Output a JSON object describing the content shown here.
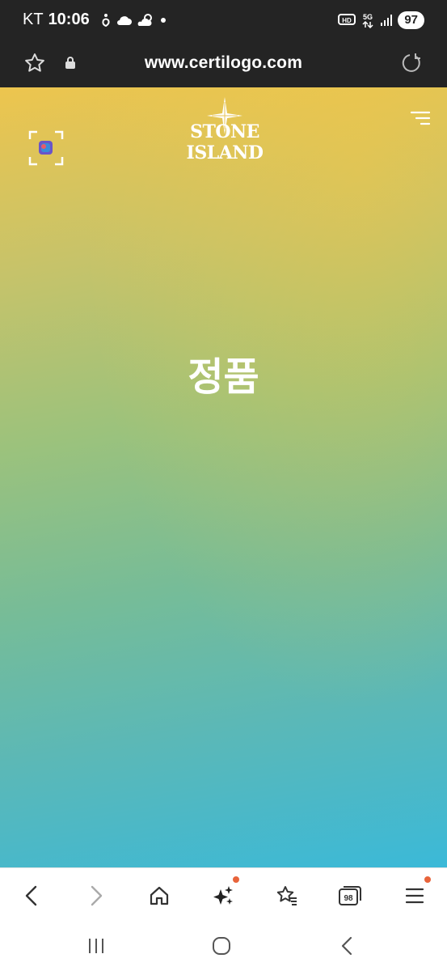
{
  "status_bar": {
    "carrier": "KT",
    "time": "10:06",
    "icons": [
      "accessibility-icon",
      "cloud-icon",
      "partly-cloudy-icon",
      "notification-dot"
    ],
    "right_icons": [
      "hd-voice-icon",
      "5g-icon",
      "signal-icon"
    ],
    "battery": "97"
  },
  "browser": {
    "url": "www.certilogo.com"
  },
  "page": {
    "brand": "STONE ISLAND",
    "verdict": "정품",
    "colors": {
      "gradient_top": "#edc54e",
      "gradient_mid": "#9cc27c",
      "gradient_bottom": "#3bb9d8"
    }
  },
  "toolbar": {
    "tabs_count": "98",
    "items": [
      "back-icon",
      "forward-icon",
      "home-icon",
      "sparkle-icon",
      "bookmarks-icon",
      "tabs-icon",
      "menu-icon"
    ],
    "badge_color": "#e8643b"
  },
  "nav": {
    "items": [
      "recent-apps-icon",
      "home-circle-icon",
      "back-chevron-icon"
    ]
  }
}
